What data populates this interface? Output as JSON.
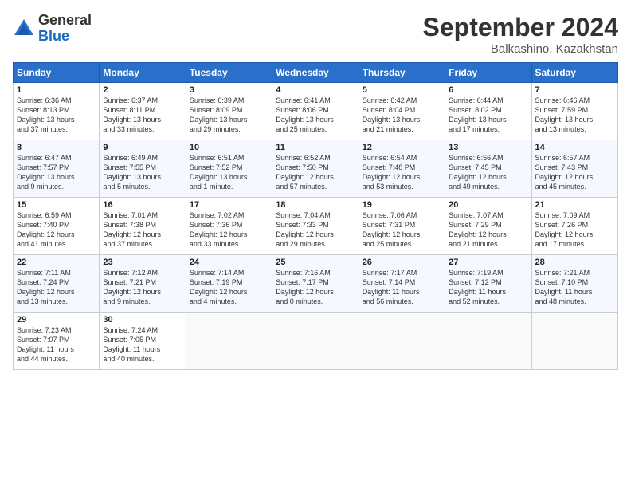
{
  "header": {
    "logo_general": "General",
    "logo_blue": "Blue",
    "month": "September 2024",
    "location": "Balkashino, Kazakhstan"
  },
  "weekdays": [
    "Sunday",
    "Monday",
    "Tuesday",
    "Wednesday",
    "Thursday",
    "Friday",
    "Saturday"
  ],
  "weeks": [
    [
      {
        "day": "1",
        "info": "Sunrise: 6:36 AM\nSunset: 8:13 PM\nDaylight: 13 hours\nand 37 minutes."
      },
      {
        "day": "2",
        "info": "Sunrise: 6:37 AM\nSunset: 8:11 PM\nDaylight: 13 hours\nand 33 minutes."
      },
      {
        "day": "3",
        "info": "Sunrise: 6:39 AM\nSunset: 8:09 PM\nDaylight: 13 hours\nand 29 minutes."
      },
      {
        "day": "4",
        "info": "Sunrise: 6:41 AM\nSunset: 8:06 PM\nDaylight: 13 hours\nand 25 minutes."
      },
      {
        "day": "5",
        "info": "Sunrise: 6:42 AM\nSunset: 8:04 PM\nDaylight: 13 hours\nand 21 minutes."
      },
      {
        "day": "6",
        "info": "Sunrise: 6:44 AM\nSunset: 8:02 PM\nDaylight: 13 hours\nand 17 minutes."
      },
      {
        "day": "7",
        "info": "Sunrise: 6:46 AM\nSunset: 7:59 PM\nDaylight: 13 hours\nand 13 minutes."
      }
    ],
    [
      {
        "day": "8",
        "info": "Sunrise: 6:47 AM\nSunset: 7:57 PM\nDaylight: 13 hours\nand 9 minutes."
      },
      {
        "day": "9",
        "info": "Sunrise: 6:49 AM\nSunset: 7:55 PM\nDaylight: 13 hours\nand 5 minutes."
      },
      {
        "day": "10",
        "info": "Sunrise: 6:51 AM\nSunset: 7:52 PM\nDaylight: 13 hours\nand 1 minute."
      },
      {
        "day": "11",
        "info": "Sunrise: 6:52 AM\nSunset: 7:50 PM\nDaylight: 12 hours\nand 57 minutes."
      },
      {
        "day": "12",
        "info": "Sunrise: 6:54 AM\nSunset: 7:48 PM\nDaylight: 12 hours\nand 53 minutes."
      },
      {
        "day": "13",
        "info": "Sunrise: 6:56 AM\nSunset: 7:45 PM\nDaylight: 12 hours\nand 49 minutes."
      },
      {
        "day": "14",
        "info": "Sunrise: 6:57 AM\nSunset: 7:43 PM\nDaylight: 12 hours\nand 45 minutes."
      }
    ],
    [
      {
        "day": "15",
        "info": "Sunrise: 6:59 AM\nSunset: 7:40 PM\nDaylight: 12 hours\nand 41 minutes."
      },
      {
        "day": "16",
        "info": "Sunrise: 7:01 AM\nSunset: 7:38 PM\nDaylight: 12 hours\nand 37 minutes."
      },
      {
        "day": "17",
        "info": "Sunrise: 7:02 AM\nSunset: 7:36 PM\nDaylight: 12 hours\nand 33 minutes."
      },
      {
        "day": "18",
        "info": "Sunrise: 7:04 AM\nSunset: 7:33 PM\nDaylight: 12 hours\nand 29 minutes."
      },
      {
        "day": "19",
        "info": "Sunrise: 7:06 AM\nSunset: 7:31 PM\nDaylight: 12 hours\nand 25 minutes."
      },
      {
        "day": "20",
        "info": "Sunrise: 7:07 AM\nSunset: 7:29 PM\nDaylight: 12 hours\nand 21 minutes."
      },
      {
        "day": "21",
        "info": "Sunrise: 7:09 AM\nSunset: 7:26 PM\nDaylight: 12 hours\nand 17 minutes."
      }
    ],
    [
      {
        "day": "22",
        "info": "Sunrise: 7:11 AM\nSunset: 7:24 PM\nDaylight: 12 hours\nand 13 minutes."
      },
      {
        "day": "23",
        "info": "Sunrise: 7:12 AM\nSunset: 7:21 PM\nDaylight: 12 hours\nand 9 minutes."
      },
      {
        "day": "24",
        "info": "Sunrise: 7:14 AM\nSunset: 7:19 PM\nDaylight: 12 hours\nand 4 minutes."
      },
      {
        "day": "25",
        "info": "Sunrise: 7:16 AM\nSunset: 7:17 PM\nDaylight: 12 hours\nand 0 minutes."
      },
      {
        "day": "26",
        "info": "Sunrise: 7:17 AM\nSunset: 7:14 PM\nDaylight: 11 hours\nand 56 minutes."
      },
      {
        "day": "27",
        "info": "Sunrise: 7:19 AM\nSunset: 7:12 PM\nDaylight: 11 hours\nand 52 minutes."
      },
      {
        "day": "28",
        "info": "Sunrise: 7:21 AM\nSunset: 7:10 PM\nDaylight: 11 hours\nand 48 minutes."
      }
    ],
    [
      {
        "day": "29",
        "info": "Sunrise: 7:23 AM\nSunset: 7:07 PM\nDaylight: 11 hours\nand 44 minutes."
      },
      {
        "day": "30",
        "info": "Sunrise: 7:24 AM\nSunset: 7:05 PM\nDaylight: 11 hours\nand 40 minutes."
      },
      {
        "day": "",
        "info": ""
      },
      {
        "day": "",
        "info": ""
      },
      {
        "day": "",
        "info": ""
      },
      {
        "day": "",
        "info": ""
      },
      {
        "day": "",
        "info": ""
      }
    ]
  ]
}
